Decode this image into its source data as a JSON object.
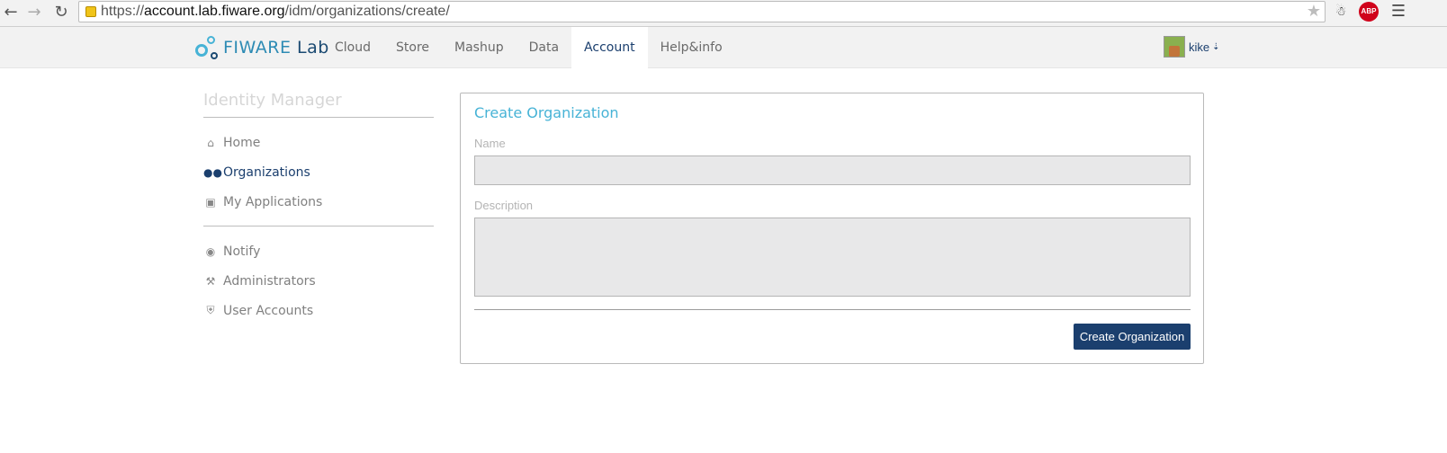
{
  "browser": {
    "url_prefix": "https://",
    "url_host": "account.lab.fiware.org",
    "url_path": "/idm/organizations/create/",
    "extensions": [
      {
        "name": "evernote-icon"
      },
      {
        "name": "adblock-plus-icon",
        "label": "ABP",
        "color": "#d0021b"
      }
    ]
  },
  "brand": {
    "name_main": "FIWARE",
    "name_lab": "Lab",
    "color_primary": "#47b3d6",
    "color_dark": "#1b3f6e"
  },
  "topnav": {
    "items": [
      {
        "label": "Cloud",
        "active": false
      },
      {
        "label": "Store",
        "active": false
      },
      {
        "label": "Mashup",
        "active": false
      },
      {
        "label": "Data",
        "active": false
      },
      {
        "label": "Account",
        "active": true
      },
      {
        "label": "Help&info",
        "active": false
      }
    ],
    "user": {
      "name": "kike",
      "menu_icon": "double-chevron-down-icon"
    }
  },
  "sidebar": {
    "title": "Identity Manager",
    "main_items": [
      {
        "label": "Home",
        "icon": "home-icon",
        "active": false
      },
      {
        "label": "Organizations",
        "icon": "users-icon",
        "active": true
      },
      {
        "label": "My Applications",
        "icon": "cube-icon",
        "active": false
      }
    ],
    "admin_items": [
      {
        "label": "Notify",
        "icon": "comment-icon",
        "active": false
      },
      {
        "label": "Administrators",
        "icon": "wrench-icon",
        "active": false
      },
      {
        "label": "User Accounts",
        "icon": "shield-icon",
        "active": false
      }
    ]
  },
  "form": {
    "title": "Create Organization",
    "name_label": "Name",
    "name_value": "",
    "description_label": "Description",
    "description_value": "",
    "submit_label": "Create Organization"
  }
}
